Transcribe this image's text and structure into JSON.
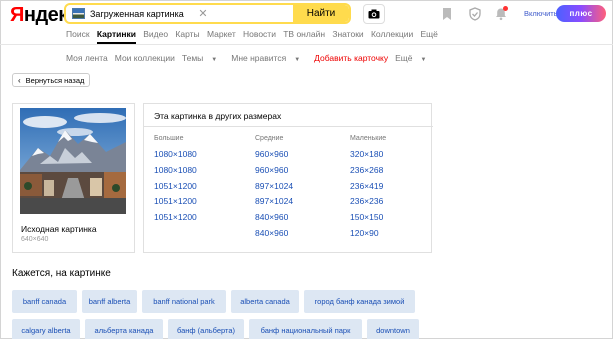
{
  "header": {
    "logo_first": "Я",
    "logo_rest": "ндекс",
    "search_value": "Загруженная картинка",
    "find_label": "Найти",
    "plus_enable": "Включить",
    "plus_badge": "плюс"
  },
  "service_nav": [
    "Поиск",
    "Картинки",
    "Видео",
    "Карты",
    "Маркет",
    "Новости",
    "ТВ онлайн",
    "Знатоки",
    "Коллекции",
    "Ещё"
  ],
  "sub_nav": {
    "feed": "Моя лента",
    "collections": "Мои коллекции",
    "topics": "Темы",
    "liked": "Мне нравится",
    "add_card": "Добавить карточку",
    "more": "Ещё"
  },
  "back_label": "Вернуться назад",
  "original": {
    "label": "Исходная картинка",
    "size": "640×640"
  },
  "sizes": {
    "title": "Эта картинка в других размерах",
    "large_head": "Большие",
    "medium_head": "Средние",
    "small_head": "Маленькие",
    "large": [
      "1080×1080",
      "1080×1080",
      "1051×1200",
      "1051×1200",
      "1051×1200"
    ],
    "medium": [
      "960×960",
      "960×960",
      "897×1024",
      "897×1024",
      "840×960",
      "840×960"
    ],
    "small": [
      "320×180",
      "236×268",
      "236×419",
      "236×236",
      "150×150",
      "120×90"
    ]
  },
  "related": {
    "title": "Кажется, на картинке",
    "tags": [
      "banff canada",
      "banff alberta",
      "banff national park",
      "alberta canada",
      "город банф канада зимой",
      "calgary alberta",
      "альберта канада",
      "банф (альберта)",
      "банф национальный парк",
      "downtown"
    ]
  },
  "colors": {
    "accent_yellow": "#ffdb4d",
    "link_blue": "#1a4fb5",
    "tag_bg": "#dde7f3",
    "logo_red": "#ff0000"
  }
}
